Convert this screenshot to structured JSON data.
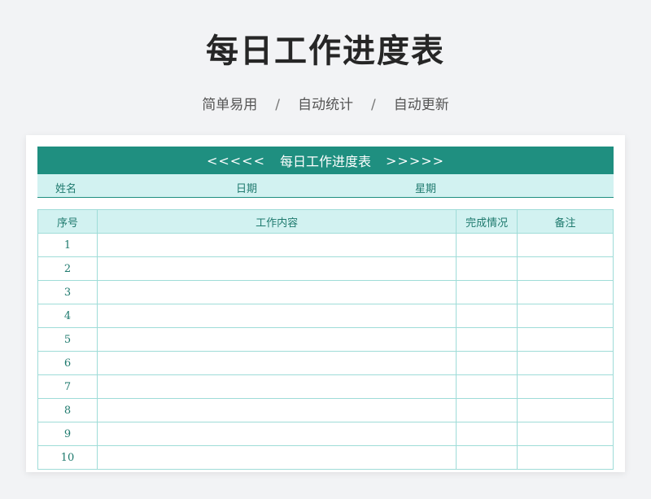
{
  "page": {
    "title": "每日工作进度表",
    "tagline": [
      "简单易用",
      "自动统计",
      "自动更新"
    ],
    "tagline_separator": "/"
  },
  "sheet": {
    "banner": {
      "left_arrows": "<<<<<",
      "title": "每日工作进度表",
      "right_arrows": ">>>>>"
    },
    "info": {
      "name_label": "姓名",
      "date_label": "日期",
      "weekday_label": "星期"
    },
    "table": {
      "headers": [
        "序号",
        "工作内容",
        "完成情况",
        "备注"
      ],
      "rows": [
        {
          "no": "1",
          "content": "",
          "status": "",
          "note": ""
        },
        {
          "no": "2",
          "content": "",
          "status": "",
          "note": ""
        },
        {
          "no": "3",
          "content": "",
          "status": "",
          "note": ""
        },
        {
          "no": "4",
          "content": "",
          "status": "",
          "note": ""
        },
        {
          "no": "5",
          "content": "",
          "status": "",
          "note": ""
        },
        {
          "no": "6",
          "content": "",
          "status": "",
          "note": ""
        },
        {
          "no": "7",
          "content": "",
          "status": "",
          "note": ""
        },
        {
          "no": "8",
          "content": "",
          "status": "",
          "note": ""
        },
        {
          "no": "9",
          "content": "",
          "status": "",
          "note": ""
        },
        {
          "no": "10",
          "content": "",
          "status": "",
          "note": ""
        }
      ]
    }
  },
  "colors": {
    "accent": "#1f8f80",
    "header_fill": "#d2f2f1",
    "grid_line": "#9fdcd8",
    "text_teal": "#1f7a6e",
    "background": "#f2f3f5"
  }
}
